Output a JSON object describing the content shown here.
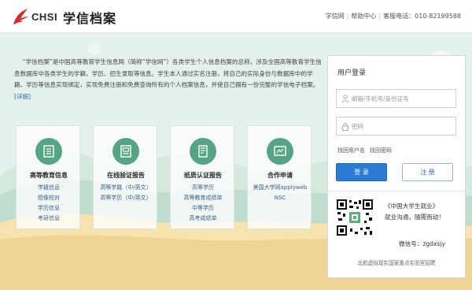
{
  "header": {
    "brand_text": "CHSI",
    "site_title": "学信档案",
    "links": [
      "学信网",
      "帮助中心"
    ],
    "hotline": "客服电话：010-82199588"
  },
  "intro": {
    "text": "“学信档案”是中国高等教育学生信息网（简称“学信网”）各类学生个人信息档案的总称，涉及全国高等教育学生信息数据库中各类学生的学籍、学历、招生录取等信息。学生本人通过实名注册，将自己的实际身份与数据库中的学籍、学历等信息实现绑定，实现免费注册和免费查询所有的个人档案信息，并使自己拥有一份完整的学信电子档案。",
    "detail_link": "[详细]"
  },
  "cards": [
    {
      "title": "高等教育信息",
      "icon": "document-list-icon",
      "items": [
        "学籍信息",
        "图像校对",
        "学历信息",
        "考研信息"
      ]
    },
    {
      "title": "在线验证报告",
      "icon": "report-icon",
      "items": [
        "高等学籍（中/英文）",
        "高等学历（中/英文）"
      ]
    },
    {
      "title": "纸质认证报告",
      "icon": "paper-report-icon",
      "items": [
        "高等学历",
        "高等教育成绩单",
        "中等学历",
        "高考成绩单"
      ]
    },
    {
      "title": "合作申请",
      "icon": "certificate-icon",
      "items": [
        "美国大学网applyweb",
        "NSC"
      ]
    }
  ],
  "login": {
    "title": "用户登录",
    "username_placeholder": "邮箱/手机号/身份证号",
    "password_placeholder": "密码",
    "find_username": "找回用户名",
    "find_password": "找回密码",
    "login_button": "登 录",
    "register_button": "注 册"
  },
  "promo": {
    "line1": "《中国大学生就业》",
    "line2": "就业沟通，随需而动！",
    "wechat": "微信号：zgdxsjy",
    "lab_note": "北航虚拟现实国家重点实验室招聘"
  },
  "colors": {
    "accent": "#2b7bd6",
    "card_icon": "#56a386",
    "hero_bg": "#e4f1ec",
    "sand": "#f6e3ad"
  }
}
